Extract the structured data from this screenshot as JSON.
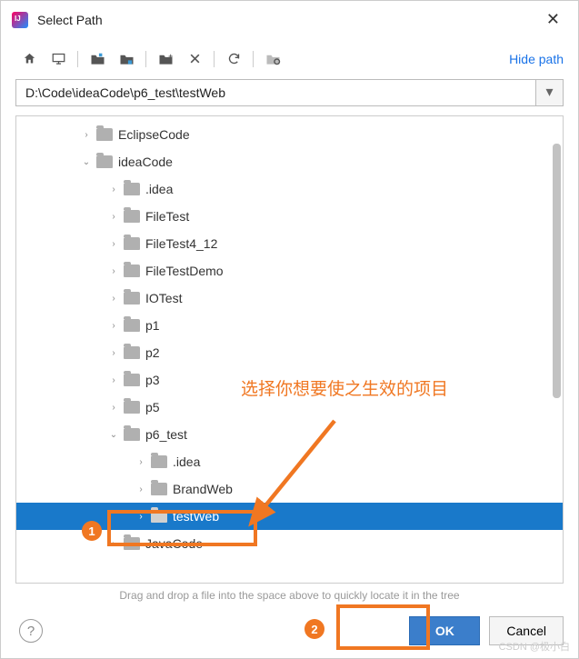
{
  "dialog": {
    "title": "Select Path",
    "close": "✕"
  },
  "toolbar": {
    "hide_path": "Hide path"
  },
  "path": {
    "value": "D:\\Code\\ideaCode\\p6_test\\testWeb"
  },
  "tree": {
    "items": [
      {
        "indent": 70,
        "arrow": "›",
        "label": "EclipseCode",
        "selected": false
      },
      {
        "indent": 70,
        "arrow": "⌄",
        "label": "ideaCode",
        "selected": false
      },
      {
        "indent": 100,
        "arrow": "›",
        "label": ".idea",
        "selected": false
      },
      {
        "indent": 100,
        "arrow": "›",
        "label": "FileTest",
        "selected": false
      },
      {
        "indent": 100,
        "arrow": "›",
        "label": "FileTest4_12",
        "selected": false
      },
      {
        "indent": 100,
        "arrow": "›",
        "label": "FileTestDemo",
        "selected": false
      },
      {
        "indent": 100,
        "arrow": "›",
        "label": "IOTest",
        "selected": false
      },
      {
        "indent": 100,
        "arrow": "›",
        "label": "p1",
        "selected": false
      },
      {
        "indent": 100,
        "arrow": "›",
        "label": "p2",
        "selected": false
      },
      {
        "indent": 100,
        "arrow": "›",
        "label": "p3",
        "selected": false
      },
      {
        "indent": 100,
        "arrow": "›",
        "label": "p5",
        "selected": false
      },
      {
        "indent": 100,
        "arrow": "⌄",
        "label": "p6_test",
        "selected": false
      },
      {
        "indent": 130,
        "arrow": "›",
        "label": ".idea",
        "selected": false
      },
      {
        "indent": 130,
        "arrow": "›",
        "label": "BrandWeb",
        "selected": false
      },
      {
        "indent": 130,
        "arrow": "›",
        "label": "testWeb",
        "selected": true
      },
      {
        "indent": 100,
        "arrow": "›",
        "label": "JavaCode",
        "selected": false
      }
    ]
  },
  "hint": "Drag and drop a file into the space above to quickly locate it in the tree",
  "footer": {
    "help": "?",
    "ok": "OK",
    "cancel": "Cancel"
  },
  "annotation": {
    "text": "选择你想要使之生效的项目",
    "badge1": "1",
    "badge2": "2"
  },
  "watermark": "CSDN @极小白"
}
